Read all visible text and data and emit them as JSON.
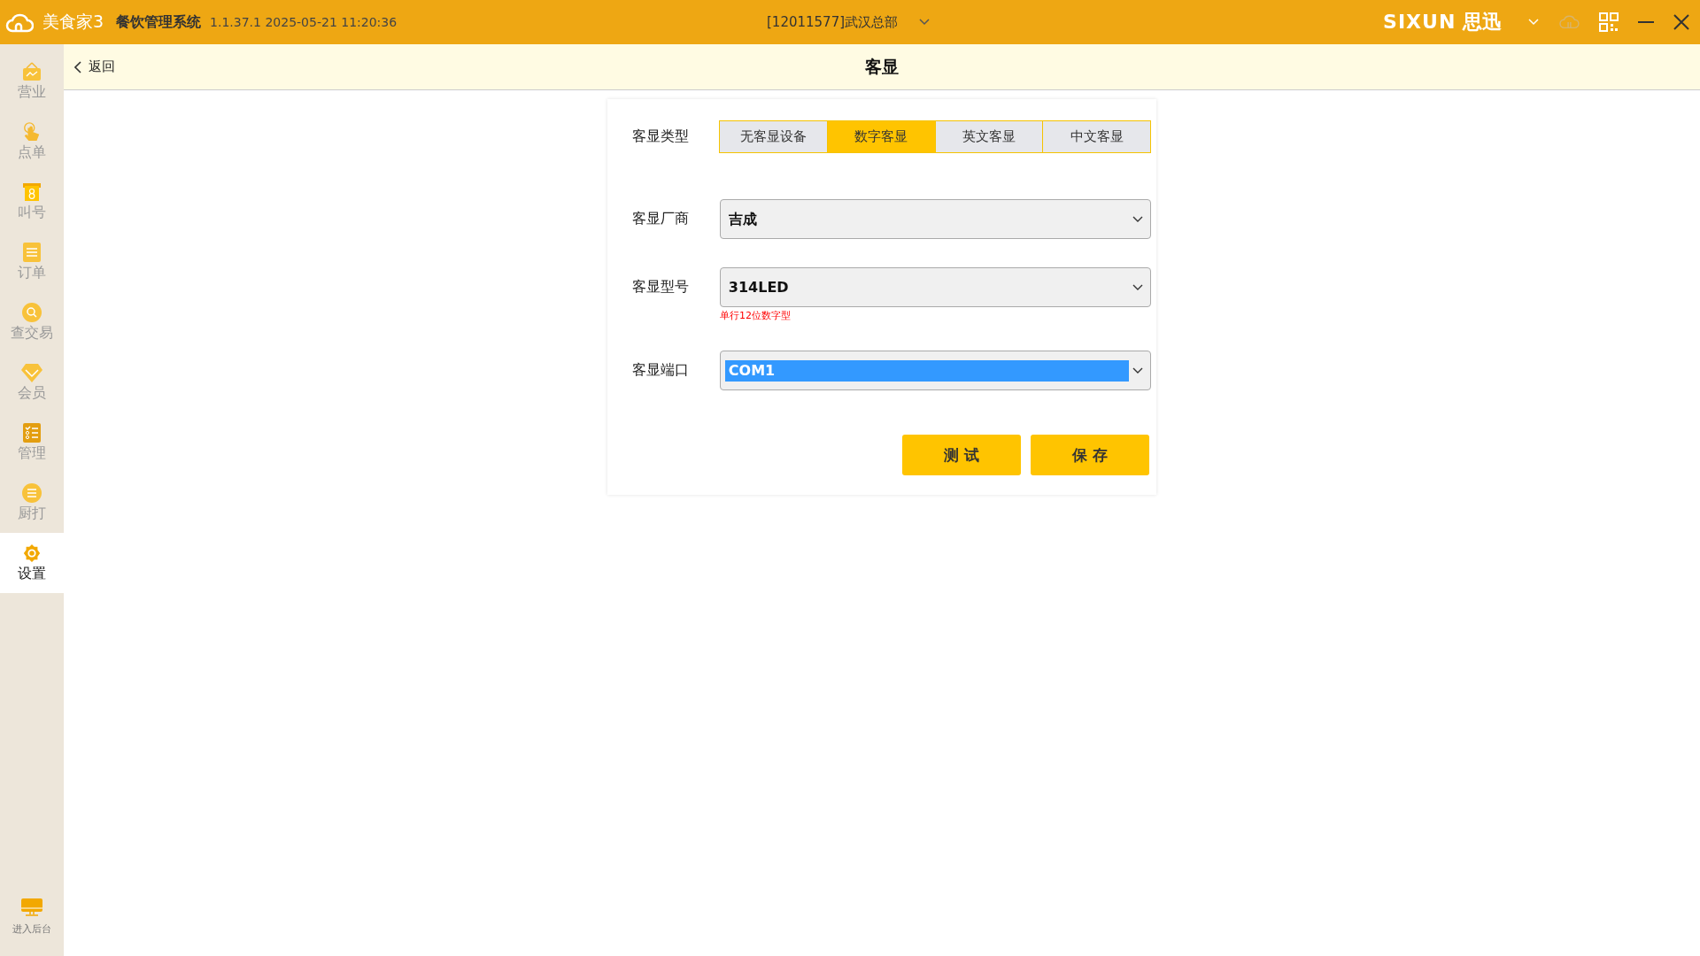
{
  "titlebar": {
    "app_name": "美食家3",
    "system_name": "餐饮管理系统",
    "version": "1.1.37.1 2025-05-21 11:20:36",
    "store": "[12011577]武汉总部",
    "brand_latin": "SIXUN",
    "brand_cn": "思迅"
  },
  "sidebar": {
    "items": [
      {
        "label": "营业",
        "kind": "bag",
        "selected": false
      },
      {
        "label": "点单",
        "kind": "hand",
        "selected": false
      },
      {
        "label": "叫号",
        "kind": "ticket",
        "selected": false
      },
      {
        "label": "订单",
        "kind": "list",
        "selected": false
      },
      {
        "label": "查交易",
        "kind": "search",
        "selected": false
      },
      {
        "label": "会员",
        "kind": "diamond",
        "selected": false
      },
      {
        "label": "管理",
        "kind": "checklist",
        "selected": false
      },
      {
        "label": "厨打",
        "kind": "menu",
        "selected": false
      },
      {
        "label": "设置",
        "kind": "gear",
        "selected": true
      }
    ],
    "bottom": {
      "label": "进入后台"
    }
  },
  "header": {
    "back": "返回",
    "title": "客显"
  },
  "form": {
    "type": {
      "label": "客显类型",
      "options": [
        {
          "label": "无客显设备",
          "selected": false
        },
        {
          "label": "数字客显",
          "selected": true
        },
        {
          "label": "英文客显",
          "selected": false
        },
        {
          "label": "中文客显",
          "selected": false
        }
      ]
    },
    "fields": [
      {
        "label": "客显厂商",
        "value": "吉成",
        "highlighted": false
      },
      {
        "label": "客显型号",
        "value": "314LED",
        "highlighted": false,
        "hint": "单行12位数字型"
      },
      {
        "label": "客显端口",
        "value": "COM1",
        "highlighted": true
      }
    ],
    "buttons": [
      "测 试",
      "保 存"
    ]
  }
}
